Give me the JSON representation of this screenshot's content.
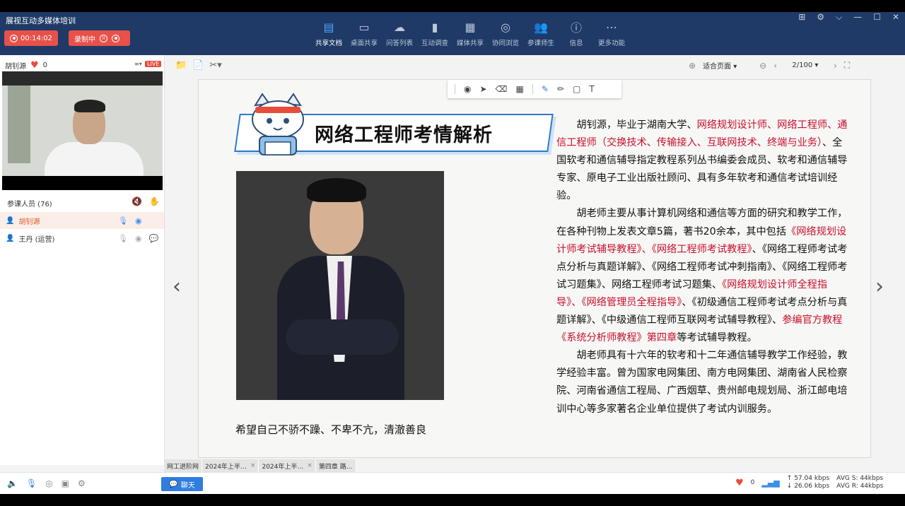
{
  "app": {
    "title": "展视互动多媒体培训"
  },
  "status": {
    "timer": "00:14:02",
    "recording_label": "录制中"
  },
  "toolbar": {
    "tools": [
      {
        "label": "共享文档",
        "icon": "document-icon",
        "active": true
      },
      {
        "label": "桌面共享",
        "icon": "desktop-icon"
      },
      {
        "label": "问答列表",
        "icon": "qa-icon"
      },
      {
        "label": "互动调查",
        "icon": "chart-icon"
      },
      {
        "label": "媒体共享",
        "icon": "film-icon"
      },
      {
        "label": "协同浏览",
        "icon": "compass-icon"
      },
      {
        "label": "参课师生",
        "icon": "users-icon"
      },
      {
        "label": "信息",
        "icon": "info-icon"
      },
      {
        "label": "更多功能",
        "icon": "more-icon"
      }
    ]
  },
  "presenter": {
    "name": "胡钊源",
    "likes": "0",
    "live_badge": "LIVE"
  },
  "participants": {
    "header": "参课人员 (76)",
    "rows": [
      {
        "name": "胡钊源",
        "selected": true
      },
      {
        "name": "王丹 (运营)",
        "selected": false
      }
    ]
  },
  "doc": {
    "zoom": "适合页面",
    "page": "2/100"
  },
  "slide": {
    "title": "网络工程师考情解析",
    "caption": "希望自己不骄不躁、不卑不亢，清澈善良",
    "bio": [
      [
        {
          "t": "胡钊源，毕业于湖南大学、",
          "red": false
        },
        {
          "t": "网络规划设计师、网络工程师、通信工程师（交换技术、传输接入、互联网技术、终端与业务）",
          "red": true
        },
        {
          "t": "、全国软考和通信辅导指定教程系列丛书编委会成员、软考和通信辅导专家、原电子工业出版社顾问、具有多年软考和通信考试培训经验。",
          "red": false
        }
      ],
      [
        {
          "t": "胡老师主要从事计算机网络和通信等方面的研究和教学工作，在各种刊物上发表文章5篇，著书20余本，其中包括",
          "red": false
        },
        {
          "t": "《网络规划设计师考试辅导教程》、《网络工程师考试教程》",
          "red": true
        },
        {
          "t": "、《网络工程师考试考点分析与真题详解》、《网络工程师考试冲刺指南》、《网络工程师考试习题集》、网络工程师考试习题集、",
          "red": false
        },
        {
          "t": "《网络规划设计师全程指导》、《网络管理员全程指导》",
          "red": true
        },
        {
          "t": "、《初级通信工程师考试考点分析与真题详解》、《中级通信工程师互联网考试辅导教程》、",
          "red": false
        },
        {
          "t": "参编官方教程《系统分析师教程》第四章",
          "red": true
        },
        {
          "t": "等考试辅导教程。",
          "red": false
        }
      ],
      [
        {
          "t": "胡老师具有十六年的软考和十二年通信辅导教学工作经验，教学经验丰富。曾为国家电网集团、南方电网集团、湖南省人民检察院、河南省通信工程局、广西烟草、贵州邮电规划局、浙江邮电培训中心等多家著名企业单位提供了考试内训服务。",
          "red": false
        }
      ]
    ]
  },
  "tabs": [
    {
      "label": "网工进阶网"
    },
    {
      "label": "2024年上半…"
    },
    {
      "label": "2024年上半…"
    },
    {
      "label": "第四章 路…"
    }
  ],
  "bottom": {
    "chat_label": "聊天",
    "likes": "0",
    "up_rate": "57.04 kbps",
    "down_rate": "26.06 kbps",
    "avg_s": "AVG S: 44kbps",
    "avg_r": "AVG R: 44kbps"
  },
  "colors": {
    "topbar": "#1f3a66",
    "accent": "#e8514a",
    "highlight": "#c8102e",
    "link_blue": "#2f7de1"
  }
}
